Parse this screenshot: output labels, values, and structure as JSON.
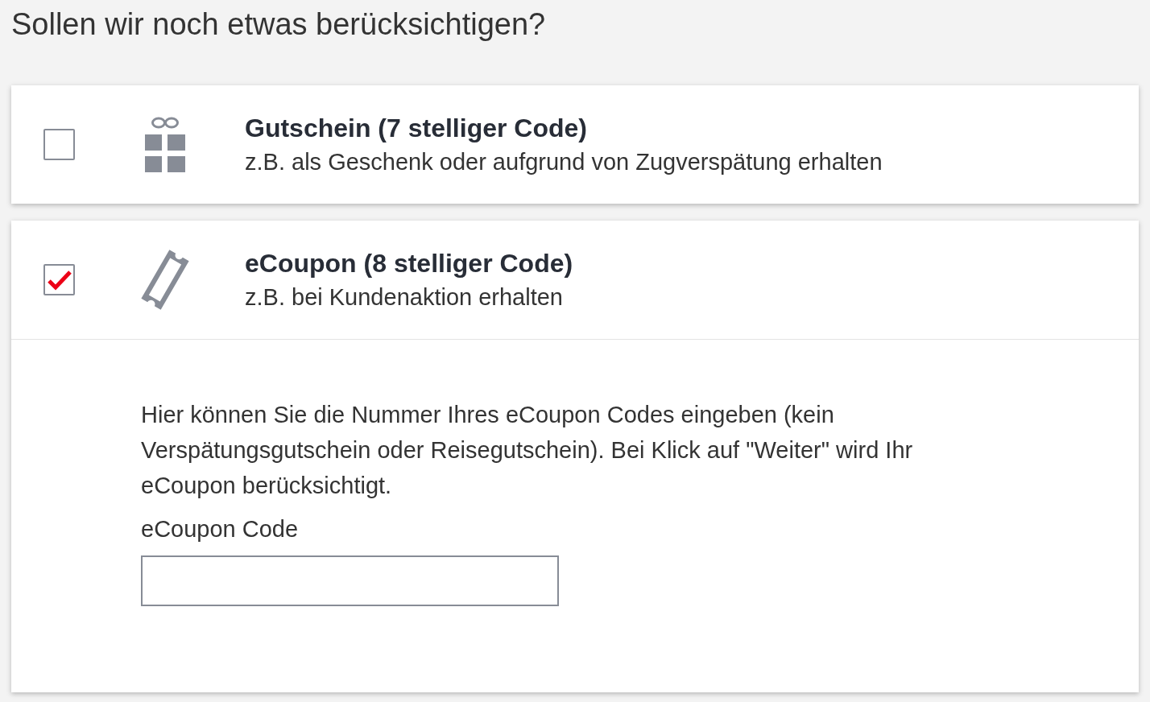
{
  "heading": "Sollen wir noch etwas berücksichtigen?",
  "options": [
    {
      "kind": "gift",
      "title": "Gutschein (7 stelliger Code)",
      "subtitle": "z.B. als Geschenk oder aufgrund von Zugverspätung erhalten",
      "checked": false
    },
    {
      "kind": "ticket",
      "title": "eCoupon (8 stelliger Code)",
      "subtitle": "z.B. bei Kundenaktion erhalten",
      "checked": true,
      "details": {
        "description": "Hier können Sie die Nummer Ihres eCoupon Codes eingeben (kein Verspätungsgutschein oder Reisegutschein). Bei Klick auf \"Weiter\" wird Ihr eCoupon berücksichtigt.",
        "field": {
          "label": "eCoupon Code"
        }
      }
    }
  ]
}
